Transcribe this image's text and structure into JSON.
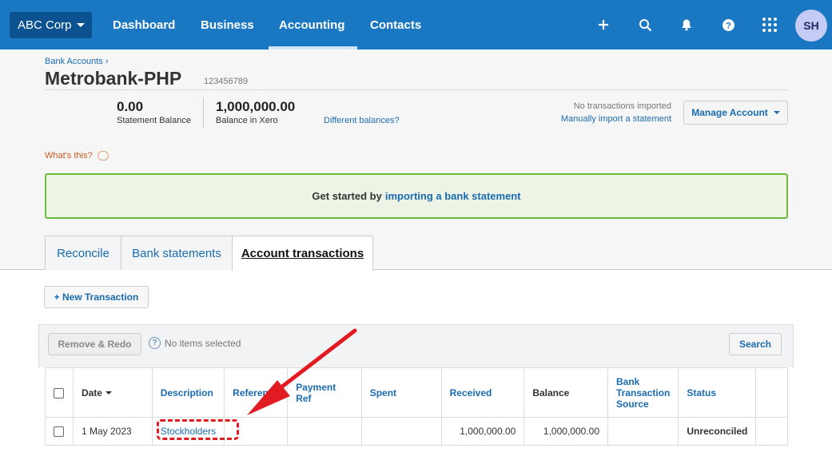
{
  "nav": {
    "org": "ABC Corp",
    "links": [
      "Dashboard",
      "Business",
      "Accounting",
      "Contacts"
    ],
    "active": "Accounting",
    "avatar": "SH",
    "icons": [
      "plus-icon",
      "search-icon",
      "bell-icon",
      "help-icon",
      "apps-grid-icon"
    ]
  },
  "header": {
    "breadcrumb": "Bank Accounts ›",
    "title": "Metrobank-PHP",
    "account_number": "123456789"
  },
  "balances": {
    "statement_value": "0.00",
    "statement_label": "Statement Balance",
    "xero_value": "1,000,000.00",
    "xero_label": "Balance in Xero",
    "different_link": "Different balances?"
  },
  "import": {
    "status": "No transactions imported",
    "manual_link": "Manually import a statement",
    "manage_button": "Manage Account"
  },
  "whats_this": "What's this?",
  "banner": {
    "text": "Get started by",
    "link": "importing a bank statement"
  },
  "tabs": [
    "Reconcile",
    "Bank statements",
    "Account transactions"
  ],
  "active_tab": "Account transactions",
  "toolbar": {
    "new_transaction": "+ New Transaction",
    "remove_redo": "Remove & Redo",
    "no_items": "No items selected",
    "search": "Search"
  },
  "table": {
    "columns": [
      "Date",
      "Description",
      "Reference",
      "Payment Ref",
      "Spent",
      "Received",
      "Balance",
      "Bank Transaction Source",
      "Status"
    ],
    "rows": [
      {
        "date": "1 May 2023",
        "description": "Stockholders",
        "reference": "",
        "payment_ref": "",
        "spent": "",
        "received": "1,000,000.00",
        "balance": "1,000,000.00",
        "source": "",
        "status": "Unreconciled"
      }
    ]
  },
  "colors": {
    "nav_bg": "#1a78c2",
    "link": "#1a6bb0",
    "banner_border": "#6cbb3c",
    "status_unreconciled": "#e07a16",
    "annotation": "#e21b23"
  }
}
